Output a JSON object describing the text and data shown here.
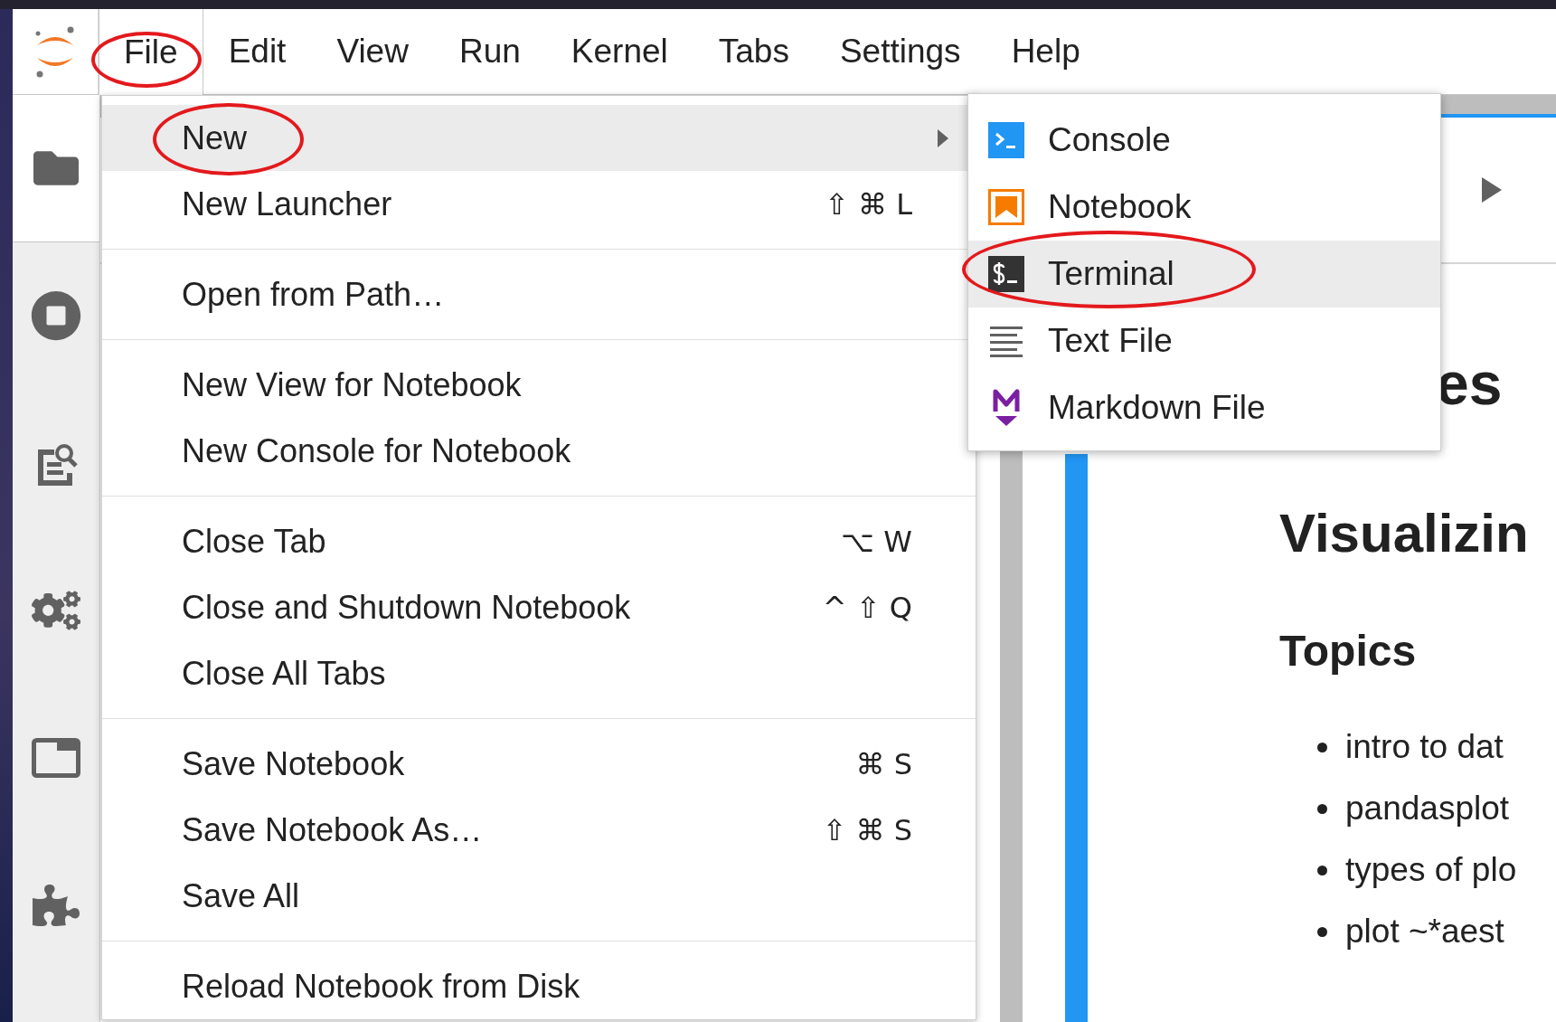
{
  "menubar": {
    "items": [
      {
        "label": "File",
        "selected": true,
        "circled": true
      },
      {
        "label": "Edit",
        "selected": false,
        "circled": false
      },
      {
        "label": "View",
        "selected": false,
        "circled": false
      },
      {
        "label": "Run",
        "selected": false,
        "circled": false
      },
      {
        "label": "Kernel",
        "selected": false,
        "circled": false
      },
      {
        "label": "Tabs",
        "selected": false,
        "circled": false
      },
      {
        "label": "Settings",
        "selected": false,
        "circled": false
      },
      {
        "label": "Help",
        "selected": false,
        "circled": false
      }
    ]
  },
  "sidebar": {
    "items": [
      {
        "kind": "files",
        "selected": true
      },
      {
        "kind": "running",
        "selected": false
      },
      {
        "kind": "inspector",
        "selected": false
      },
      {
        "kind": "settings",
        "selected": false
      },
      {
        "kind": "tabs",
        "selected": false
      },
      {
        "kind": "extensions",
        "selected": false
      }
    ]
  },
  "file_menu": {
    "sections": [
      {
        "items": [
          {
            "label": "New",
            "has_submenu": true,
            "selected": true,
            "circled": true
          },
          {
            "label": "New Launcher",
            "shortcut": "⇧ ⌘ L",
            "has_submenu": false,
            "selected": false,
            "circled": false
          }
        ]
      },
      {
        "items": [
          {
            "label": "Open from Path…",
            "has_submenu": false,
            "selected": false,
            "circled": false
          }
        ]
      },
      {
        "items": [
          {
            "label": "New View for Notebook",
            "has_submenu": false,
            "selected": false,
            "circled": false
          },
          {
            "label": "New Console for Notebook",
            "has_submenu": false,
            "selected": false,
            "circled": false
          }
        ]
      },
      {
        "items": [
          {
            "label": "Close Tab",
            "shortcut": "⌥ W",
            "has_submenu": false,
            "selected": false,
            "circled": false
          },
          {
            "label": "Close and Shutdown Notebook",
            "shortcut": "^ ⇧ Q",
            "has_submenu": false,
            "selected": false,
            "circled": false
          },
          {
            "label": "Close All Tabs",
            "has_submenu": false,
            "selected": false,
            "circled": false
          }
        ]
      },
      {
        "items": [
          {
            "label": "Save Notebook",
            "shortcut": "⌘ S",
            "has_submenu": false,
            "selected": false,
            "circled": false
          },
          {
            "label": "Save Notebook As…",
            "shortcut": "⇧ ⌘ S",
            "has_submenu": false,
            "selected": false,
            "circled": false
          },
          {
            "label": "Save All",
            "has_submenu": false,
            "selected": false,
            "circled": false
          }
        ]
      },
      {
        "items": [
          {
            "label": "Reload Notebook from Disk",
            "has_submenu": false,
            "selected": false,
            "circled": false
          }
        ]
      }
    ]
  },
  "new_submenu": {
    "items": [
      {
        "kind": "console",
        "label": "Console",
        "selected": false,
        "circled": false
      },
      {
        "kind": "notebook",
        "label": "Notebook",
        "selected": false,
        "circled": false
      },
      {
        "kind": "terminal",
        "label": "Terminal",
        "selected": true,
        "circled": true
      },
      {
        "kind": "text",
        "label": "Text File",
        "selected": false,
        "circled": false
      },
      {
        "kind": "markdown",
        "label": "Markdown File",
        "selected": false,
        "circled": false
      }
    ]
  },
  "notebook": {
    "partial_heading": "es",
    "title": "Visualizin",
    "subtitle": "Topics",
    "bullets": [
      "intro to dat",
      "pandasplot",
      "types of plo",
      "plot ~*aest"
    ]
  }
}
